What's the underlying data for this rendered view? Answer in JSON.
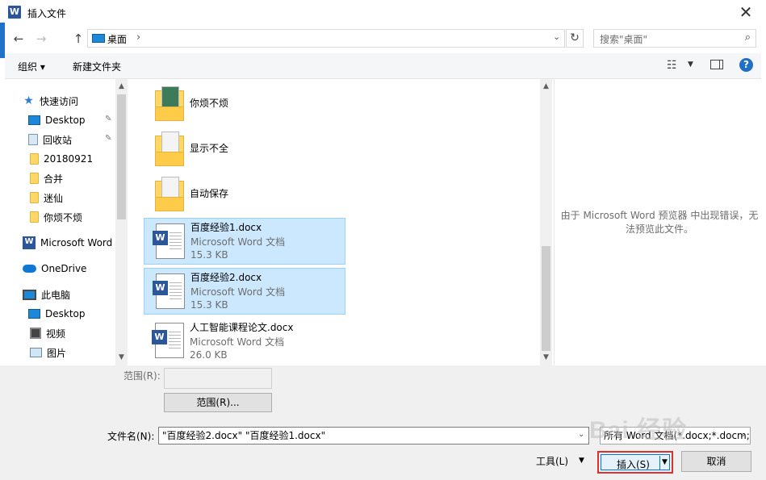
{
  "window": {
    "title": "插入文件",
    "close_glyph": "✕",
    "app_icon_letter": "W"
  },
  "address": {
    "back": "←",
    "forward": "→",
    "up": "↑",
    "location": "桌面",
    "chevron": "›",
    "dropdown": "⌄",
    "refresh": "↻"
  },
  "search": {
    "placeholder": "搜索\"桌面\"",
    "icon": "⌕"
  },
  "toolbar": {
    "organize": "组织 ▾",
    "new_folder": "新建文件夹",
    "view_glyph": "☷",
    "view_arrow": "▼",
    "help": "?"
  },
  "sidebar": {
    "items": [
      {
        "label": "快速访问",
        "icon": "star-icon"
      },
      {
        "label": "Desktop",
        "icon": "desktop-icon",
        "pinned": true
      },
      {
        "label": "回收站",
        "icon": "recycle-bin-icon",
        "pinned": true
      },
      {
        "label": "20180921",
        "icon": "folder-icon"
      },
      {
        "label": "合并",
        "icon": "folder-icon"
      },
      {
        "label": "迷仙",
        "icon": "folder-icon"
      },
      {
        "label": "你烦不烦",
        "icon": "folder-icon"
      },
      {
        "label": "Microsoft Word",
        "icon": "word-icon"
      },
      {
        "label": "OneDrive",
        "icon": "cloud-icon"
      },
      {
        "label": "此电脑",
        "icon": "computer-icon"
      },
      {
        "label": "Desktop",
        "icon": "desktop-icon"
      },
      {
        "label": "视频",
        "icon": "video-icon"
      },
      {
        "label": "图片",
        "icon": "picture-icon"
      }
    ],
    "pin_glyph": "📌"
  },
  "scroll": {
    "up": "▲",
    "down": "▼"
  },
  "files": [
    {
      "name": "你烦不烦",
      "kind": "folder"
    },
    {
      "name": "显示不全",
      "kind": "folder"
    },
    {
      "name": "自动保存",
      "kind": "folder"
    },
    {
      "name": "百度经验1.docx",
      "type": "Microsoft Word 文档",
      "size": "15.3 KB",
      "selected": true
    },
    {
      "name": "百度经验2.docx",
      "type": "Microsoft Word 文档",
      "size": "15.3 KB",
      "selected": true
    },
    {
      "name": "人工智能课程论文.docx",
      "type": "Microsoft Word 文档",
      "size": "26.0 KB",
      "selected": false
    }
  ],
  "preview": {
    "message": "由于 Microsoft Word 预览器 中出现错误，无法预览此文件。"
  },
  "bottom": {
    "range_label": "范围(R):",
    "range_button": "范围(R)...",
    "filename_label": "文件名(N):",
    "filename_value": "\"百度经验2.docx\" \"百度经验1.docx\"",
    "filter_value": "所有 Word 文档(*.docx;*.docm;*.doc",
    "tools": "工具(L)",
    "tools_arrow": "▼",
    "insert": "插入(S)",
    "insert_arrow": "▼",
    "cancel": "取消",
    "dropdown_glyph": "⌄"
  },
  "watermark": "Bai 经验",
  "colors": {
    "accent": "#0078d7",
    "selection": "#cce8ff",
    "highlight_border": "#e0302a",
    "word_blue": "#2b579a"
  }
}
